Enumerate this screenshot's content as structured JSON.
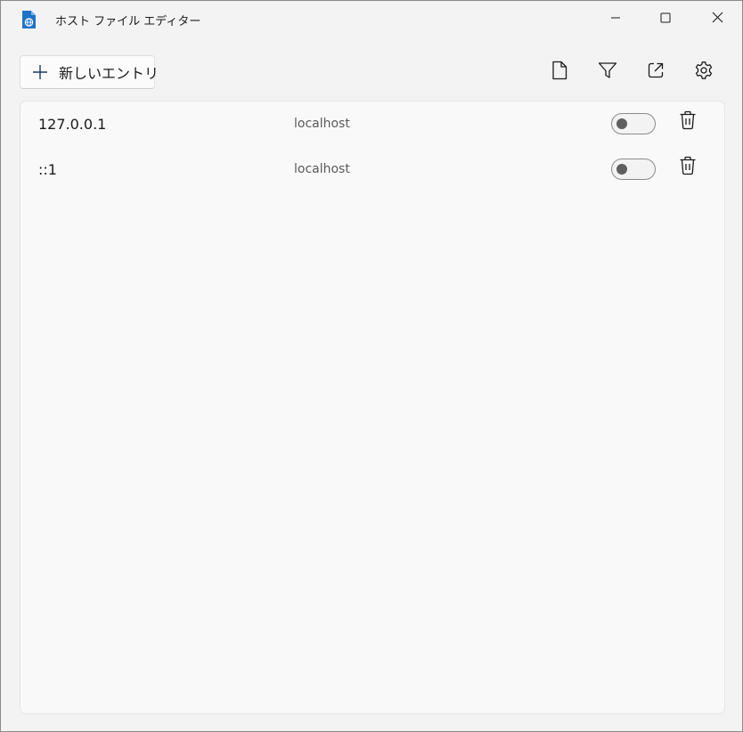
{
  "window": {
    "title": "ホスト ファイル エディター",
    "app_icon": "hosts-file-icon",
    "controls": [
      "minimize-icon",
      "maximize-icon",
      "close-icon"
    ]
  },
  "toolbar": {
    "new_entry_label": "新しいエントリ",
    "new_entry_icon": "plus-icon",
    "icons": [
      "file-icon",
      "filter-icon",
      "open-external-icon",
      "gear-icon"
    ]
  },
  "entries": [
    {
      "address": "127.0.0.1",
      "host": "localhost",
      "enabled": false
    },
    {
      "address": "::1",
      "host": "localhost",
      "enabled": false
    }
  ],
  "colors": {
    "background": "#f3f3f3",
    "panel": "#f9f9f9",
    "accent": "#005fb8",
    "toggle_knob": "#5f5f5f"
  }
}
